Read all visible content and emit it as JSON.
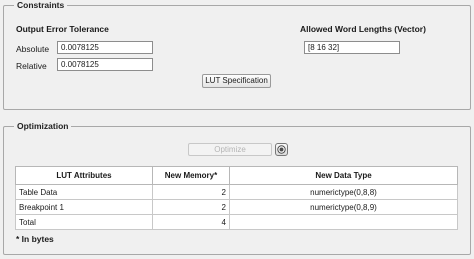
{
  "constraints": {
    "title": "Constraints",
    "output_error_heading": "Output Error Tolerance",
    "absolute_label": "Absolute",
    "absolute_value": "0.0078125",
    "relative_label": "Relative",
    "relative_value": "0.0078125",
    "word_lengths_heading": "Allowed Word Lengths (Vector)",
    "word_lengths_value": "[8 16 32]",
    "lut_spec_button": "LUT Specification"
  },
  "optimization": {
    "title": "Optimization",
    "optimize_button": "Optimize",
    "help_icon": "help-icon",
    "table": {
      "headers": [
        "LUT Attributes",
        "New Memory*",
        "New Data Type"
      ],
      "rows": [
        {
          "attribute": "Table Data",
          "memory": "2",
          "type": "numerictype(0,8,8)"
        },
        {
          "attribute": "Breakpoint 1",
          "memory": "2",
          "type": "numerictype(0,8,9)"
        },
        {
          "attribute": "Total",
          "memory": "4",
          "type": ""
        }
      ]
    },
    "footnote": "* In bytes"
  }
}
